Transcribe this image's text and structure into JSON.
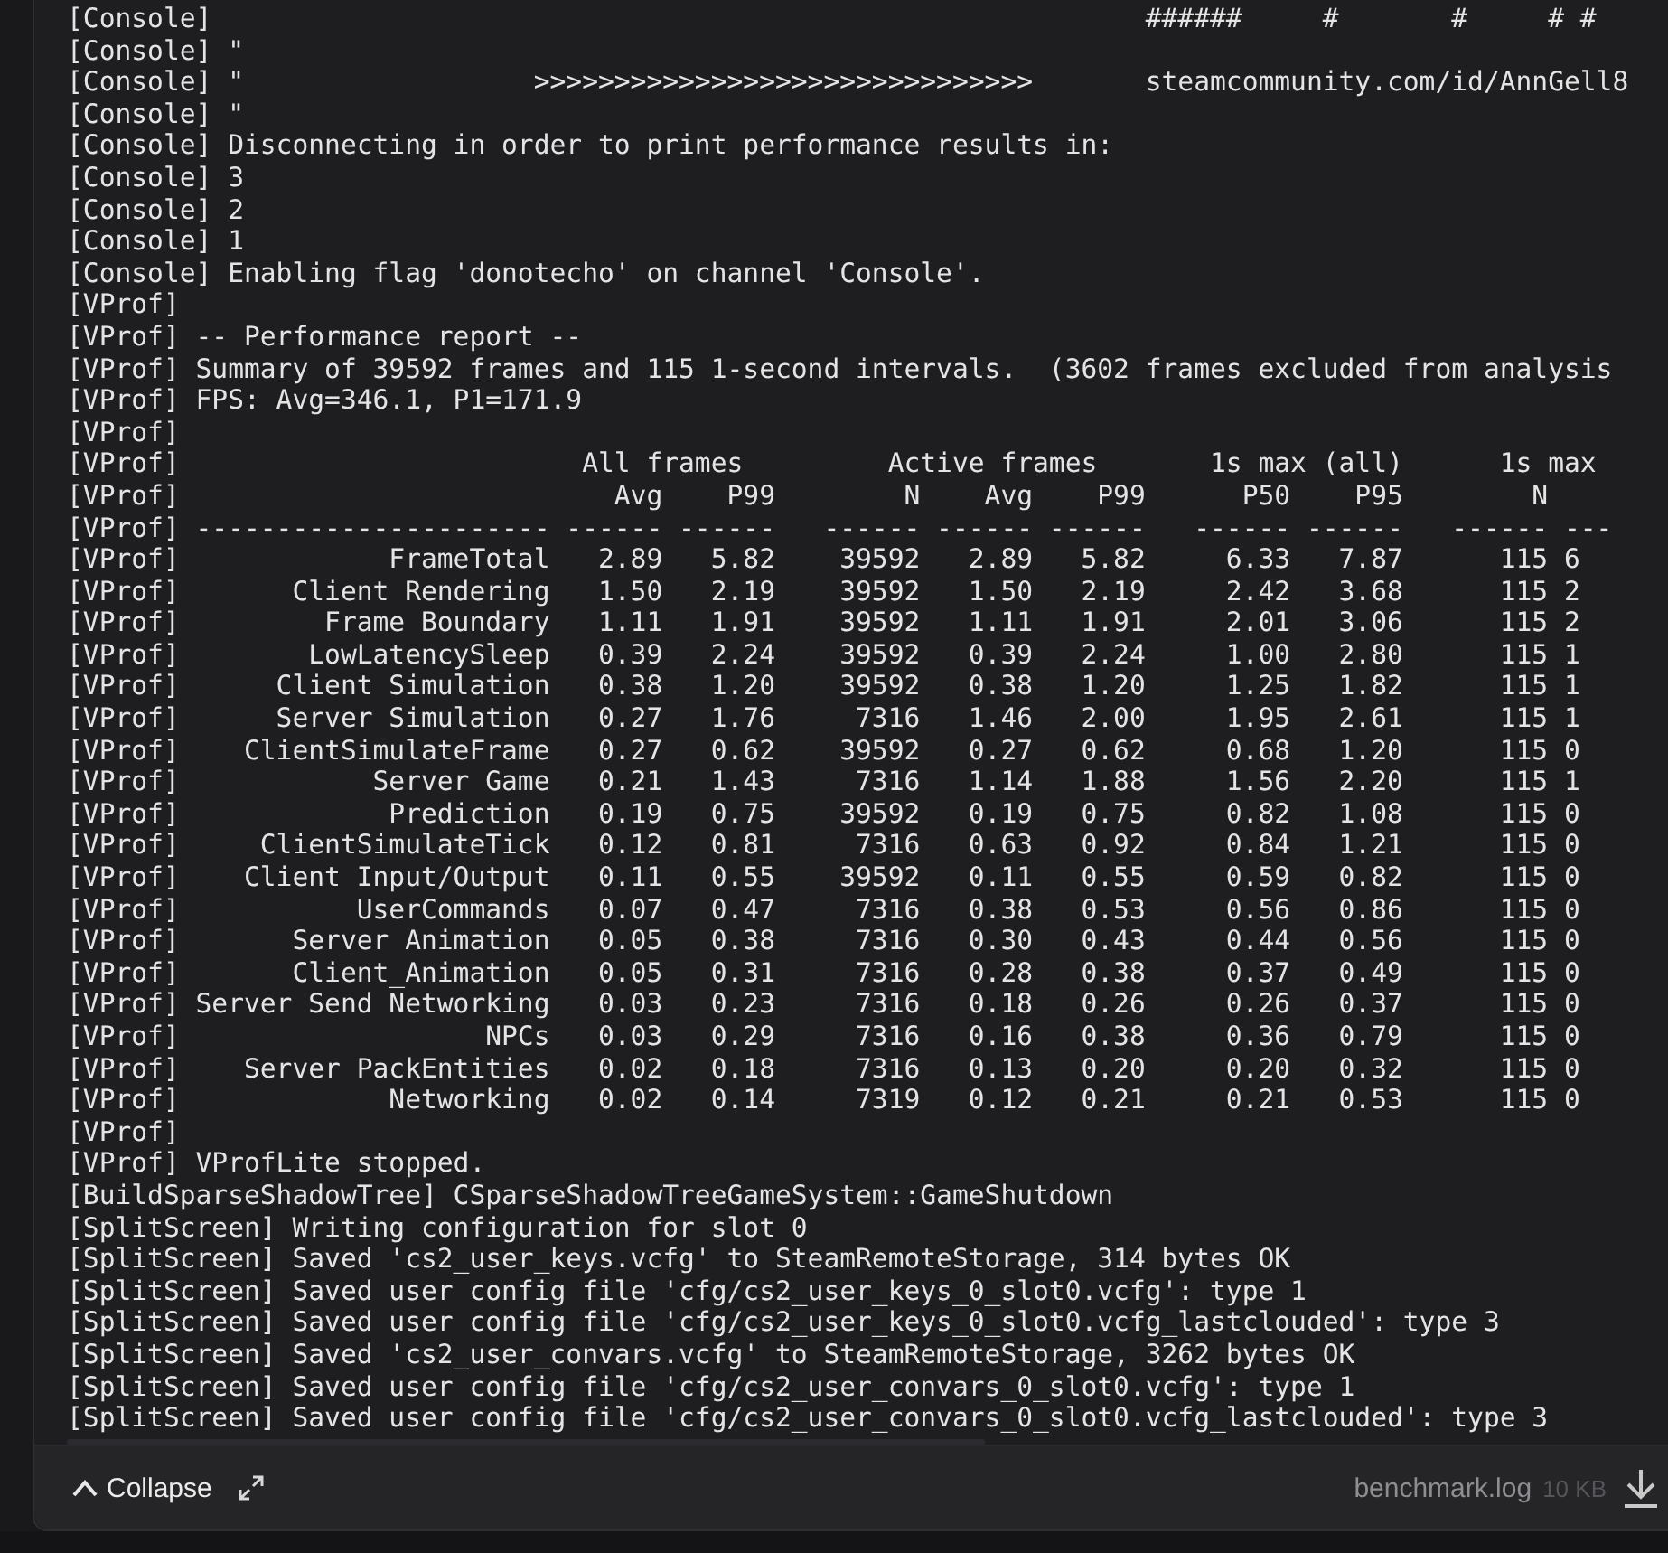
{
  "log_lines": [
    "[Console]                                                          ######     #       #     # #",
    "[Console] \"",
    "[Console] \"                  >>>>>>>>>>>>>>>>>>>>>>>>>>>>>>>       steamcommunity.com/id/AnnGell8",
    "[Console] \"",
    "[Console] Disconnecting in order to print performance results in:",
    "[Console] 3",
    "[Console] 2",
    "[Console] 1",
    "[Console] Enabling flag 'donotecho' on channel 'Console'.",
    "[VProf]",
    "[VProf] -- Performance report --",
    "[VProf] Summary of 39592 frames and 115 1-second intervals.  (3602 frames excluded from analysis",
    "[VProf] FPS: Avg=346.1, P1=171.9",
    "[VProf]",
    "[VProf]                         All frames         Active frames       1s max (all)      1s max",
    "[VProf]                           Avg    P99        N    Avg    P99      P50    P95        N",
    "[VProf] ---------------------- ------ ------   ------ ------ ------   ------ ------   ------ ---",
    "[VProf]             FrameTotal   2.89   5.82    39592   2.89   5.82     6.33   7.87      115 6",
    "[VProf]       Client Rendering   1.50   2.19    39592   1.50   2.19     2.42   3.68      115 2",
    "[VProf]         Frame Boundary   1.11   1.91    39592   1.11   1.91     2.01   3.06      115 2",
    "[VProf]        LowLatencySleep   0.39   2.24    39592   0.39   2.24     1.00   2.80      115 1",
    "[VProf]      Client Simulation   0.38   1.20    39592   0.38   1.20     1.25   1.82      115 1",
    "[VProf]      Server Simulation   0.27   1.76     7316   1.46   2.00     1.95   2.61      115 1",
    "[VProf]    ClientSimulateFrame   0.27   0.62    39592   0.27   0.62     0.68   1.20      115 0",
    "[VProf]            Server Game   0.21   1.43     7316   1.14   1.88     1.56   2.20      115 1",
    "[VProf]             Prediction   0.19   0.75    39592   0.19   0.75     0.82   1.08      115 0",
    "[VProf]     ClientSimulateTick   0.12   0.81     7316   0.63   0.92     0.84   1.21      115 0",
    "[VProf]    Client Input/Output   0.11   0.55    39592   0.11   0.55     0.59   0.82      115 0",
    "[VProf]           UserCommands   0.07   0.47     7316   0.38   0.53     0.56   0.86      115 0",
    "[VProf]       Server Animation   0.05   0.38     7316   0.30   0.43     0.44   0.56      115 0",
    "[VProf]       Client_Animation   0.05   0.31     7316   0.28   0.38     0.37   0.49      115 0",
    "[VProf] Server Send Networking   0.03   0.23     7316   0.18   0.26     0.26   0.37      115 0",
    "[VProf]                   NPCs   0.03   0.29     7316   0.16   0.38     0.36   0.79      115 0",
    "[VProf]    Server PackEntities   0.02   0.18     7316   0.13   0.20     0.20   0.32      115 0",
    "[VProf]             Networking   0.02   0.14     7319   0.12   0.21     0.21   0.53      115 0",
    "[VProf]",
    "[VProf] VProfLite stopped.",
    "[BuildSparseShadowTree] CSparseShadowTreeGameSystem::GameShutdown",
    "[SplitScreen] Writing configuration for slot 0",
    "[SplitScreen] Saved 'cs2_user_keys.vcfg' to SteamRemoteStorage, 314 bytes OK",
    "[SplitScreen] Saved user config file 'cfg/cs2_user_keys_0_slot0.vcfg': type 1",
    "[SplitScreen] Saved user config file 'cfg/cs2_user_keys_0_slot0.vcfg_lastclouded': type 3",
    "[SplitScreen] Saved 'cs2_user_convars.vcfg' to SteamRemoteStorage, 3262 bytes OK",
    "[SplitScreen] Saved user config file 'cfg/cs2_user_convars_0_slot0.vcfg': type 1",
    "[SplitScreen] Saved user config file 'cfg/cs2_user_convars_0_slot0.vcfg_lastclouded': type 3"
  ],
  "footer": {
    "collapse_label": "Collapse",
    "file_name": "benchmark.log",
    "file_size": "10 KB"
  }
}
